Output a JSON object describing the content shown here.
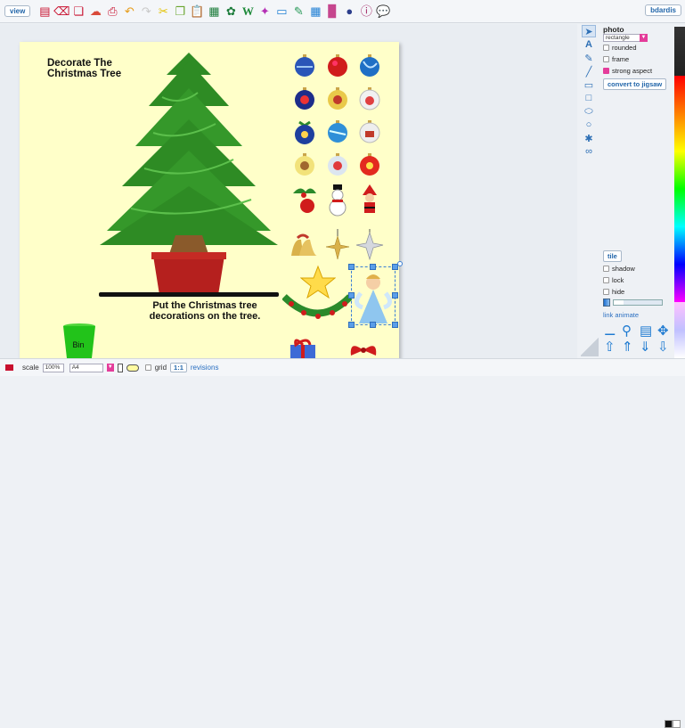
{
  "topbar": {
    "view_label": "view",
    "user_label": "bdardis"
  },
  "page": {
    "title_line1": "Decorate The",
    "title_line2": "Christmas Tree",
    "instruction_line1": "Put the Christmas tree",
    "instruction_line2": "decorations on the tree.",
    "bin_label": "Bin"
  },
  "panel": {
    "title": "photo",
    "shape_select": "rectangle",
    "options": [
      {
        "label": "rounded",
        "checked": false
      },
      {
        "label": "frame",
        "checked": false
      },
      {
        "label": "strong aspect",
        "checked": true
      }
    ],
    "convert_label": "convert to jigsaw",
    "tile_label": "tile",
    "flags": [
      {
        "label": "shadow",
        "checked": false
      },
      {
        "label": "lock",
        "checked": false
      },
      {
        "label": "hide",
        "checked": false
      }
    ],
    "transparency": 0.2,
    "link_label": "link",
    "animate_label": "animate"
  },
  "bottombar": {
    "scale_label": "scale",
    "scale_value": "100%",
    "paper_size": "A4",
    "grid_label": "grid",
    "ratio_label": "1:1",
    "revisions_label": "revisions"
  },
  "colors": {
    "accent": "#e43c9a",
    "link": "#2a6fc1",
    "page_bg": "#ffffc9",
    "tree_green": "#2e8b24",
    "pot_red": "#b5201e"
  }
}
